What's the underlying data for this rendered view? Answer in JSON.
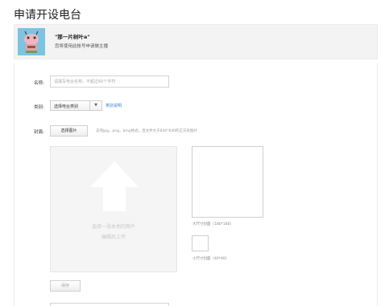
{
  "page": {
    "title": "申请开设电台"
  },
  "header": {
    "user_name": "\"那一片树叶a\"",
    "user_note": "您将使用此帐号申请做主播"
  },
  "form": {
    "name": {
      "label": "名称:",
      "placeholder": "请填写电台名称，不超过60个字符"
    },
    "category": {
      "label": "类别:",
      "selected": "选择电台类别",
      "link": "类别说明"
    },
    "cover": {
      "label": "封面:",
      "choose_button": "选择图片",
      "hint": "支持jpg，png，bmp格式，且文件大于640*640的正方形图片",
      "upload_line1": "选择一张本地的图片",
      "upload_line2": "编辑后上传",
      "large_label": "大尺寸封面（180*180）",
      "small_label": "小尺寸封面（40*40）",
      "save_button": "保存"
    }
  },
  "colors": {
    "link": "#3a7fd6",
    "avatar_bg": "#7ec3df",
    "header_bg": "#f3f3f3"
  },
  "icons": [
    "avatar-cartoon",
    "chevron-down-icon",
    "upload-arrow-icon"
  ]
}
